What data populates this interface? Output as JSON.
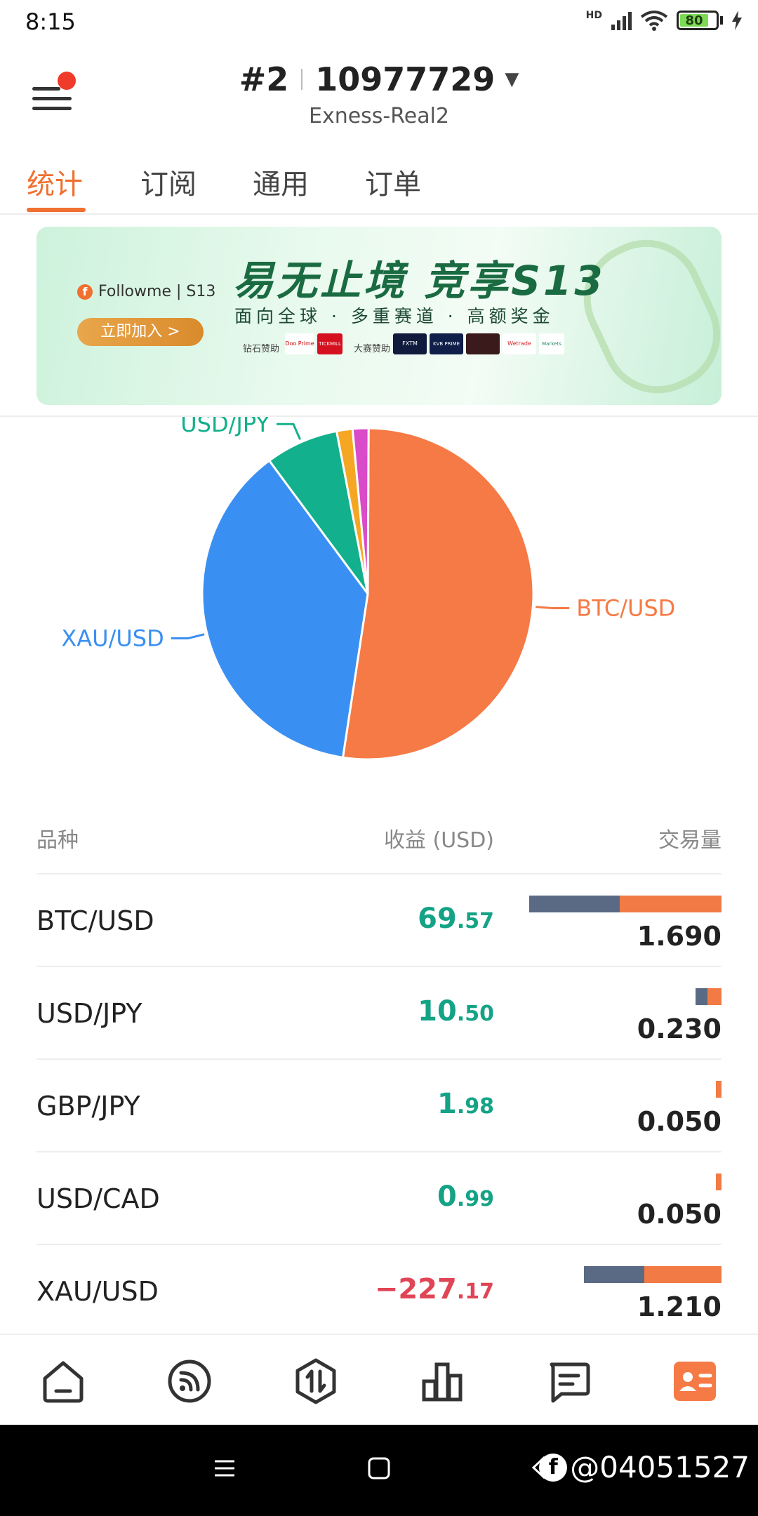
{
  "status_bar": {
    "time": "8:15",
    "network": "HD",
    "battery": "80"
  },
  "header": {
    "account_rank": "#2",
    "account_number": "10977729",
    "server": "Exness-Real2"
  },
  "tabs": [
    {
      "label": "统计",
      "active": true
    },
    {
      "label": "订阅",
      "active": false
    },
    {
      "label": "通用",
      "active": false
    },
    {
      "label": "订单",
      "active": false
    }
  ],
  "banner": {
    "logo": "Followme | S13",
    "title": "易无止境 竞享S13",
    "subtitle": "面向全球 · 多重赛道 · 高额奖金",
    "cta": "立即加入 >",
    "sponsor_label_1": "钻石赞助",
    "sponsor_label_2": "大赛赞助",
    "sponsors": [
      "Doo Prime",
      "TICKMILL",
      "FXTM",
      "KVB PRIME",
      "Wetrade",
      "Markets"
    ]
  },
  "chart_data": {
    "type": "pie",
    "title": "",
    "labels": [
      "BTC/USD",
      "XAU/USD",
      "USD/JPY",
      "GBP/JPY",
      "USD/CAD"
    ],
    "values": [
      1.69,
      1.21,
      0.23,
      0.05,
      0.05
    ],
    "colors": [
      "#F57A45",
      "#3A8FF2",
      "#12B08C",
      "#F5A623",
      "#D94BC9"
    ],
    "shown_labels": [
      "USD/JPY",
      "BTC/USD",
      "XAU/USD"
    ]
  },
  "table": {
    "headers": {
      "symbol": "品种",
      "profit": "收益 (USD)",
      "volume": "交易量"
    },
    "rows": [
      {
        "symbol": "BTC/USD",
        "profit_int": "69",
        "profit_dec": ".57",
        "sign": "pos",
        "volume": "1.690",
        "buy_share": 0.47,
        "sell_share": 0.53,
        "bar_fraction": 1.0
      },
      {
        "symbol": "USD/JPY",
        "profit_int": "10",
        "profit_dec": ".50",
        "sign": "pos",
        "volume": "0.230",
        "buy_share": 0.45,
        "sell_share": 0.55,
        "bar_fraction": 0.136
      },
      {
        "symbol": "GBP/JPY",
        "profit_int": "1",
        "profit_dec": ".98",
        "sign": "pos",
        "volume": "0.050",
        "buy_share": 0.0,
        "sell_share": 1.0,
        "bar_fraction": 0.03
      },
      {
        "symbol": "USD/CAD",
        "profit_int": "0",
        "profit_dec": ".99",
        "sign": "pos",
        "volume": "0.050",
        "buy_share": 0.0,
        "sell_share": 1.0,
        "bar_fraction": 0.03
      },
      {
        "symbol": "XAU/USD",
        "profit_int": "−227",
        "profit_dec": ".17",
        "sign": "neg",
        "volume": "1.210",
        "buy_share": 0.44,
        "sell_share": 0.56,
        "bar_fraction": 0.716
      }
    ]
  },
  "bottom_nav": [
    {
      "icon": "home-icon",
      "active": false
    },
    {
      "icon": "signal-feed-icon",
      "active": false
    },
    {
      "icon": "trade-icon",
      "active": false
    },
    {
      "icon": "chart-bars-icon",
      "active": false
    },
    {
      "icon": "message-icon",
      "active": false
    },
    {
      "icon": "profile-card-icon",
      "active": true
    }
  ],
  "colors": {
    "accent": "#F07030",
    "positive": "#14A386",
    "negative": "#E04556",
    "buy": "#5A6A85",
    "sell": "#F27A45"
  },
  "watermark": "@04051527"
}
